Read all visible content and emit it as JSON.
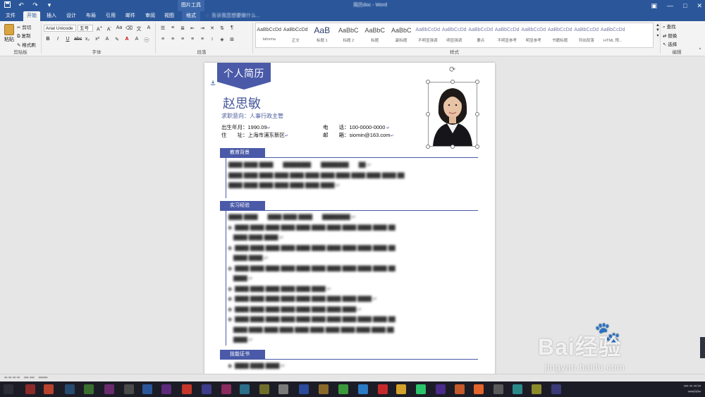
{
  "titlebar": {
    "context_tab": "图片工具",
    "doc_title": "简历doc - Word",
    "qat_icons": [
      "save-icon",
      "undo-icon",
      "redo-icon",
      "customize-icon"
    ]
  },
  "tabs": [
    "文件",
    "开始",
    "插入",
    "设计",
    "布局",
    "引用",
    "邮件",
    "审阅",
    "视图",
    "格式"
  ],
  "active_tab": "开始",
  "tell_me": "告诉我您想要做什么...",
  "clipboard": {
    "paste": "粘贴",
    "cut": "剪切",
    "copy": "复制",
    "format_painter": "格式刷",
    "group_label": "剪贴板"
  },
  "font": {
    "name": "Arial Unicode",
    "size": "五号",
    "group_label": "字体"
  },
  "paragraph": {
    "group_label": "段落"
  },
  "styles": {
    "group_label": "样式",
    "items": [
      {
        "preview": "AaBbCcDd",
        "name": "tahoma"
      },
      {
        "preview": "AaBbCcDd",
        "name": "正文"
      },
      {
        "preview": "AaB",
        "name": "标题 1"
      },
      {
        "preview": "AaBbC",
        "name": "标题 2"
      },
      {
        "preview": "AaBbC",
        "name": "标题"
      },
      {
        "preview": "AaBbC",
        "name": "副标题"
      },
      {
        "preview": "AaBbCcDd",
        "name": "不明显强调"
      },
      {
        "preview": "AaBbCcDd",
        "name": "明显强调"
      },
      {
        "preview": "AaBbCcDd",
        "name": "要点"
      },
      {
        "preview": "AaBbCcDd",
        "name": "不明显参考"
      },
      {
        "preview": "AaBbCcDd",
        "name": "明显参考"
      },
      {
        "preview": "AaBbCcDd",
        "name": "书籍标题"
      },
      {
        "preview": "AaBbCcDd",
        "name": "列出段落"
      },
      {
        "preview": "AaBbCcDd",
        "name": "HTML 预..."
      }
    ]
  },
  "editing": {
    "find": "查找",
    "replace": "替换",
    "select": "选择",
    "group_label": "编辑"
  },
  "resume": {
    "banner": "个人简历",
    "name": "赵思敏",
    "intention": "求职意向：人事行政主管",
    "birth_label": "出生年月：",
    "birth_value": "1990.09",
    "phone_label": "电　　话：",
    "phone_value": "100-0000-0000",
    "address_label": "住　　址：",
    "address_value": "上海市浦东新区",
    "email_label": "邮　　箱：",
    "email_value": "siomin@163.com",
    "sections": [
      "教育背景",
      "实习经验",
      "技能证书"
    ]
  },
  "colors": {
    "word_blue": "#2b579a",
    "resume_accent": "#4a5aa8",
    "name_color": "#4a5a9c"
  },
  "watermark": {
    "logo": "Bai经验",
    "url": "jingyan.baidu.com"
  }
}
